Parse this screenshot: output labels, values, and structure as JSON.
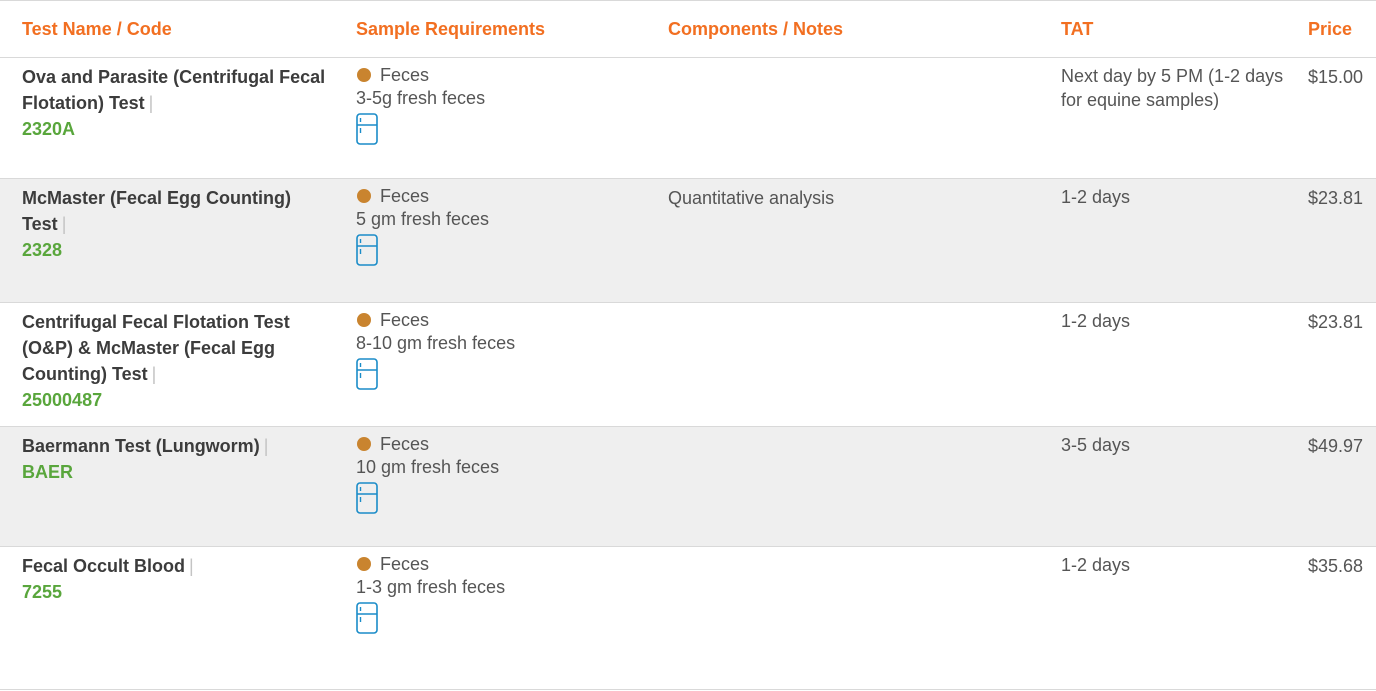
{
  "header": {
    "name": "Test Name / Code",
    "sample": "Sample Requirements",
    "notes": "Components / Notes",
    "tat": "TAT",
    "price": "Price"
  },
  "colors": {
    "header_accent": "#f26f21",
    "code_green": "#59a63c",
    "specimen_dot": "#c9842f",
    "fridge_icon": "#1a8cc8",
    "row_shade": "#efefef"
  },
  "rows": [
    {
      "name": "Ova and Parasite (Centrifugal Fecal Flotation) Test",
      "separator": "|",
      "code": "2320A",
      "specimen": "Feces",
      "amount": "3-5g fresh feces",
      "storage_icon": "refrigerator-icon",
      "notes": "",
      "tat": "Next day by 5 PM (1-2 days for equine samples)",
      "price": "$15.00"
    },
    {
      "name": "McMaster (Fecal Egg Counting) Test",
      "separator": "|",
      "code": "2328",
      "specimen": "Feces",
      "amount": "5 gm fresh feces",
      "storage_icon": "refrigerator-icon",
      "notes": "Quantitative analysis",
      "tat": "1-2 days",
      "price": "$23.81"
    },
    {
      "name": "Centrifugal Fecal Flotation Test (O&P) & McMaster (Fecal Egg Counting) Test",
      "separator": "|",
      "code": "25000487",
      "specimen": "Feces",
      "amount": "8-10 gm fresh feces",
      "storage_icon": "refrigerator-icon",
      "notes": "",
      "tat": "1-2 days",
      "price": "$23.81"
    },
    {
      "name": "Baermann Test (Lungworm)",
      "separator": "|",
      "code": "BAER",
      "specimen": "Feces",
      "amount": "10 gm fresh feces",
      "storage_icon": "refrigerator-icon",
      "notes": "",
      "tat": "3-5 days",
      "price": "$49.97"
    },
    {
      "name": "Fecal Occult Blood",
      "separator": "|",
      "code": "7255",
      "specimen": "Feces",
      "amount": "1-3 gm fresh feces",
      "storage_icon": "refrigerator-icon",
      "notes": "",
      "tat": "1-2 days",
      "price": "$35.68"
    }
  ]
}
